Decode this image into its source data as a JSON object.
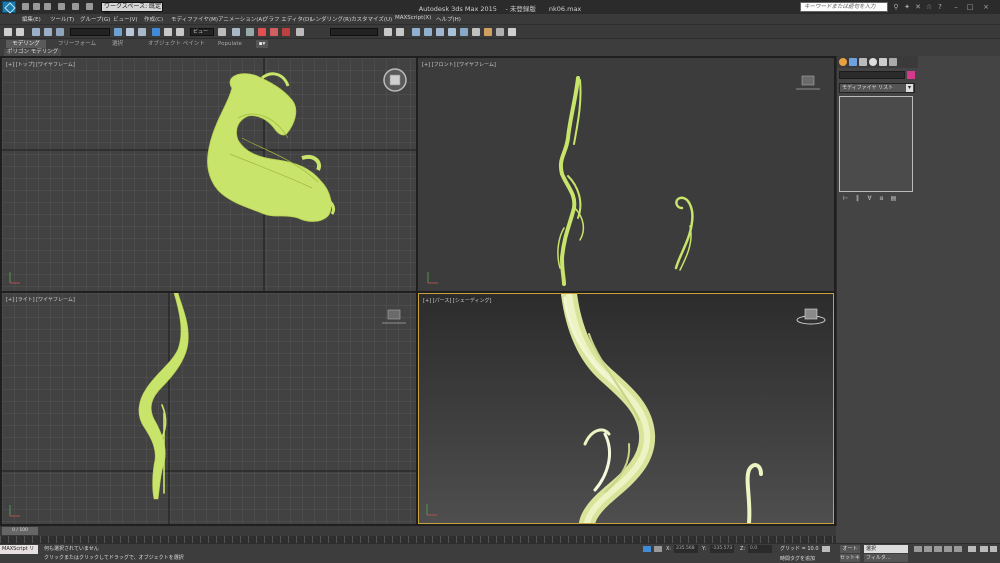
{
  "titlebar": {
    "workspace": "ワークスペース: 既定値",
    "title": "Autodesk 3ds Max 2015 　- 未登録版　　nk06.max",
    "search_placeholder": "キーワードまたは語句を入力"
  },
  "menu": [
    "編集(E)",
    "ツール(T)",
    "グループ(G)",
    "ビュー(V)",
    "作成(C)",
    "モディファイヤ(M)",
    "アニメーション(A)",
    "グラフ エディタ(D)",
    "レンダリング(R)",
    "カスタマイズ(U)",
    "MAXScript(X)",
    "ヘルプ(H)"
  ],
  "toolbar": {
    "view_dropdown": "ビュー"
  },
  "ribbon": {
    "tabs": [
      "モデリング",
      "フリーフォーム",
      "選択",
      "オブジェクト ペイント",
      "Populate"
    ],
    "sub_label": "ポリゴン モデリング"
  },
  "viewports": {
    "top": "[+] [トップ] [ワイヤフレーム]",
    "front": "[+] [フロント] [ワイヤフレーム]",
    "left": "[+] [ライト] [ワイヤフレーム]",
    "persp": "[+] [パース] [シェーディング]"
  },
  "command_panel": {
    "modifier_list": "モディファイヤ リスト"
  },
  "timeslider": {
    "frame": "0 / 100"
  },
  "statusbar": {
    "maxscript": "MAXScript リ",
    "status": "何も選択されていません",
    "prompt": "クリックまたはクリックしてドラッグで、オブジェクトを選択",
    "x_label": "X:",
    "y_label": "Y:",
    "z_label": "Z:",
    "x_value": "235.568",
    "y_value": "-135.573",
    "z_value": "0.0",
    "grid": "グリッド = 10.0",
    "time_tag": "時間タグを追加",
    "auto": "オート",
    "setkey": "セットキー",
    "selected": "選択",
    "filter": "フィルタ..."
  },
  "colors": {
    "mesh": "#c9e46a",
    "persp_mesh": "#e8efb0",
    "accent": "#c8a03c",
    "object_color": "#d43a8c"
  }
}
